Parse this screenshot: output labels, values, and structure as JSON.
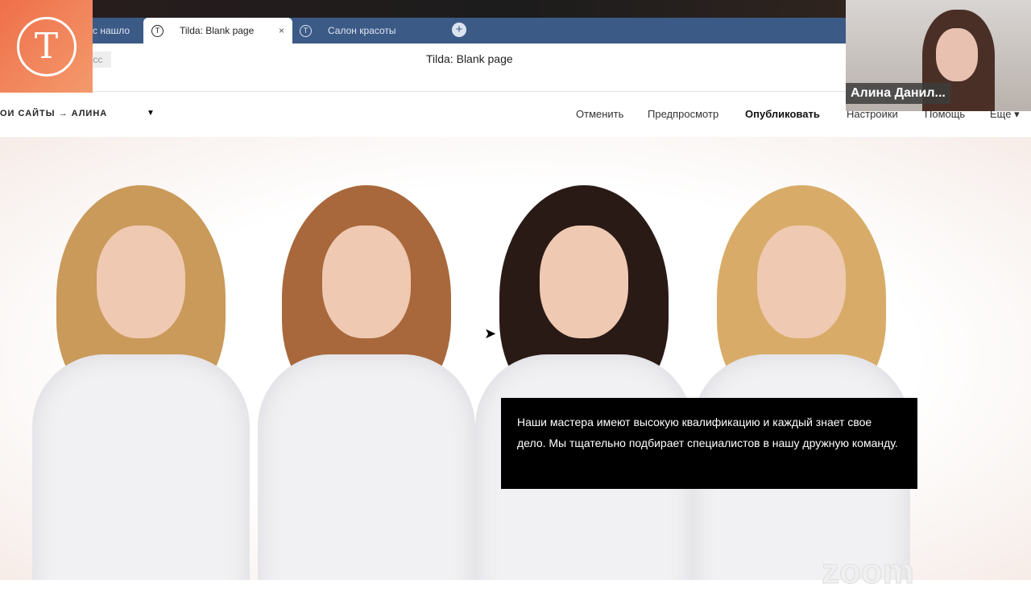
{
  "browser": {
    "tabs": [
      {
        "label": "с нашло"
      },
      {
        "label": "Tilda: Blank page",
        "close": "×"
      },
      {
        "label": "Салон красоты"
      }
    ],
    "new_tab": "+",
    "address_fragment": ".cc",
    "page_title": "Tilda: Blank page"
  },
  "logo": {
    "glyph": "T"
  },
  "editor": {
    "breadcrumb": "ОИ САЙТЫ → АЛИНА",
    "menu": [
      "Отменить",
      "Предпросмотр",
      "Опубликовать",
      "Настройки",
      "Помощь",
      "Еще ▾"
    ]
  },
  "hero": {
    "caption": "Наши мастера имеют высокую квалификацию и каждый знает свое дело. Мы тщательно подбирает специалистов в нашу дружную команду."
  },
  "video": {
    "participant": "Алина Данил...",
    "watermark": "zoom"
  }
}
